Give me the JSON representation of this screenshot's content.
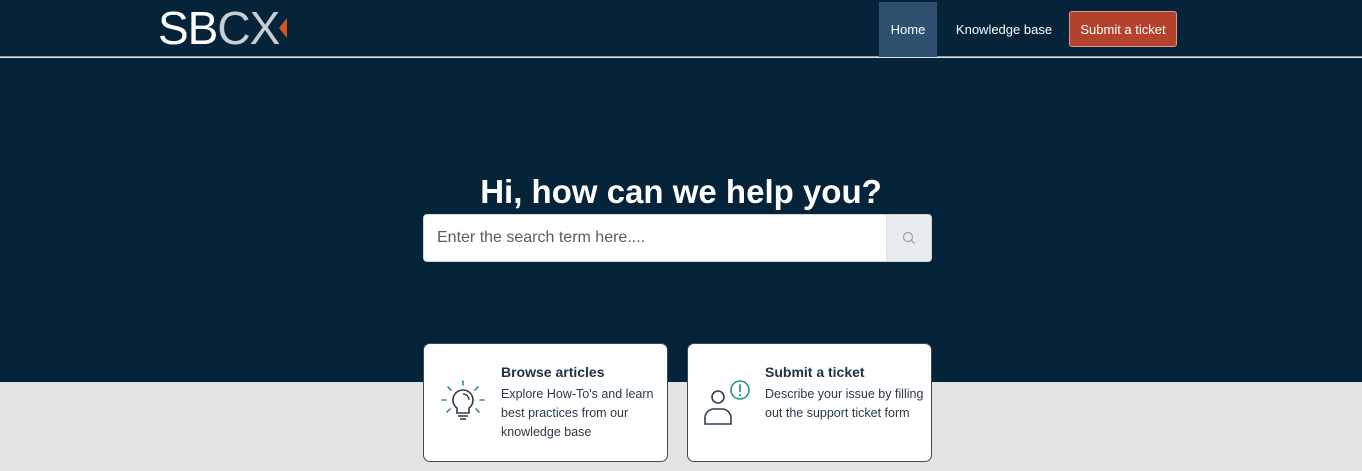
{
  "brand": {
    "logo_sb": "SB",
    "logo_cx": "CX"
  },
  "nav": {
    "home": "Home",
    "knowledge_base": "Knowledge base",
    "submit_ticket": "Submit a ticket"
  },
  "hero": {
    "title": "Hi, how can we help you?",
    "search_placeholder": "Enter the search term here...."
  },
  "cards": [
    {
      "title": "Browse articles",
      "description": "Explore How-To's and learn best practices from our knowledge base",
      "icon": "lightbulb-icon"
    },
    {
      "title": "Submit a ticket",
      "description": "Describe your issue by filling out the support ticket form",
      "icon": "person-alert-icon"
    }
  ],
  "colors": {
    "header_bg": "#05243a",
    "active_nav": "#2f5170",
    "submit_btn": "#b3432d",
    "accent_green": "#2a9d6e",
    "logo_accent": "#d8531f"
  }
}
